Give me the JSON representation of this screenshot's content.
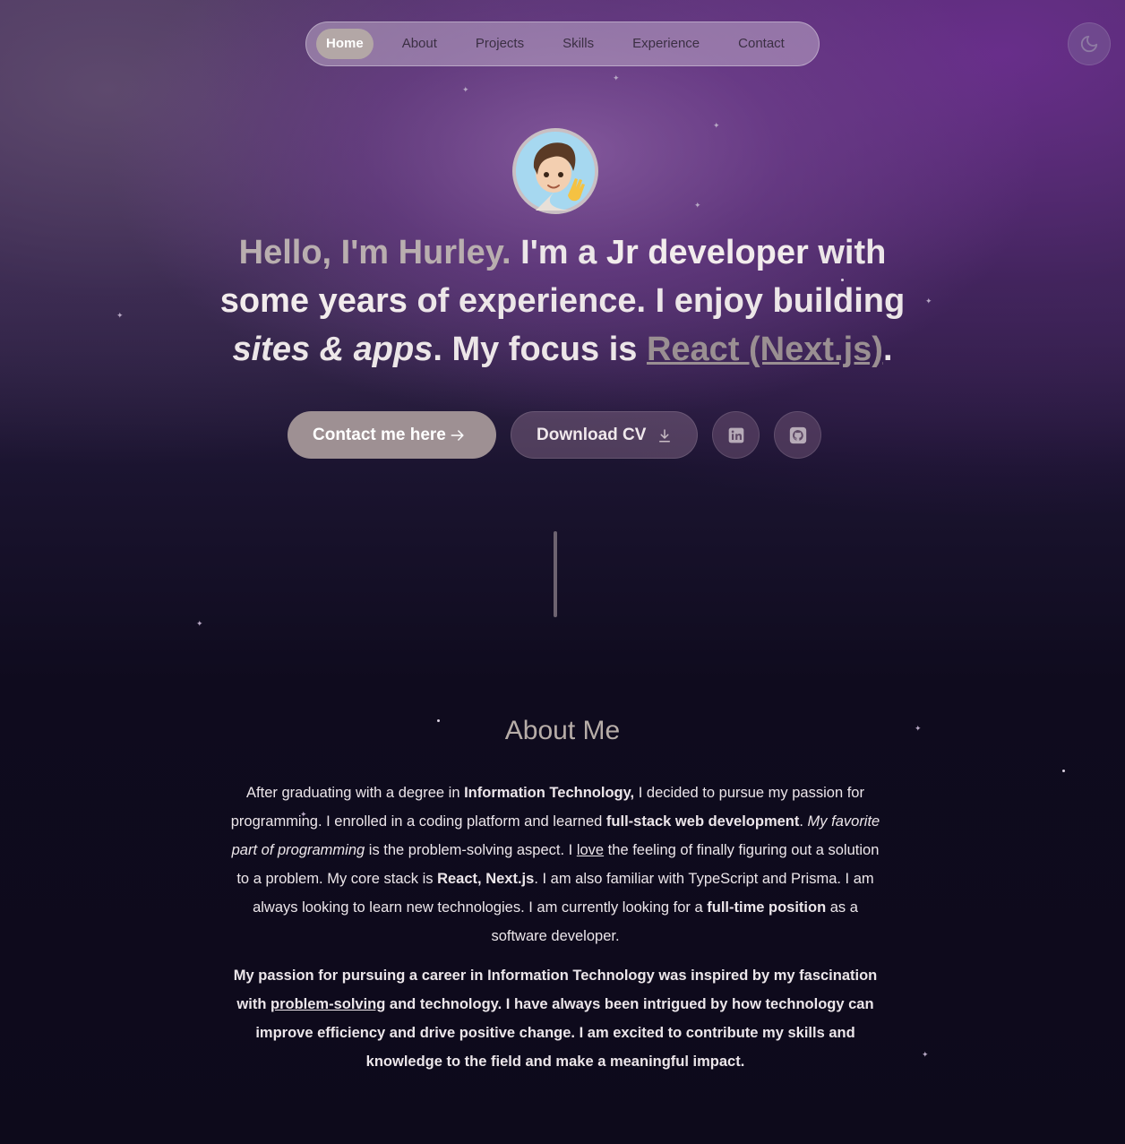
{
  "nav": {
    "items": [
      "Home",
      "About",
      "Projects",
      "Skills",
      "Experience",
      "Contact"
    ],
    "active": "Home"
  },
  "theme_toggle": {
    "icon": "moon-icon"
  },
  "avatar": {
    "icon": "memoji-waving-avatar"
  },
  "hero": {
    "greeting": "Hello, I'm Hurley.",
    "t1": " I'm a ",
    "role": "Jr developer",
    "t2": " with ",
    "years": "some years",
    "t3": " of experience. I enjoy building ",
    "things": "sites & apps",
    "t4": ". My focus is ",
    "focus": "React (Next.js)",
    "t5": "."
  },
  "buttons": {
    "contact": "Contact me here",
    "cv": "Download CV",
    "contact_icon": "arrow-right-icon",
    "cv_icon": "download-icon",
    "linkedin_icon": "linkedin-icon",
    "github_icon": "github-icon"
  },
  "about": {
    "title": "About Me",
    "p1": {
      "a": "After graduating with a degree in ",
      "b": "Information Technology,",
      "c": " I decided to pursue my passion for programming. I enrolled in a coding platform and learned ",
      "d": "full-stack web development",
      "e": ". ",
      "f": "My favorite part of programming",
      "g": " is the problem-solving aspect. I ",
      "h": "love",
      "i": " the feeling of finally figuring out a solution to a problem. My core stack is ",
      "j": "React, Next.js",
      "k": ". I am also familiar with TypeScript and Prisma. I am always looking to learn new technologies. I am currently looking for a ",
      "l": "full-time position",
      "m": " as a software developer."
    },
    "p2": {
      "a": "My passion for pursuing a career in Information Technology was inspired by my fascination with ",
      "b": "problem-solving",
      "c": " and technology. I have always been intrigued by how technology can improve efficiency and drive positive change. I am excited to contribute my skills and knowledge to the field and make a meaningful impact."
    }
  },
  "colors": {
    "accent_purple": "#6b2e8a",
    "background_dark": "#0e0b1c",
    "button_primary": "#9e9093"
  }
}
